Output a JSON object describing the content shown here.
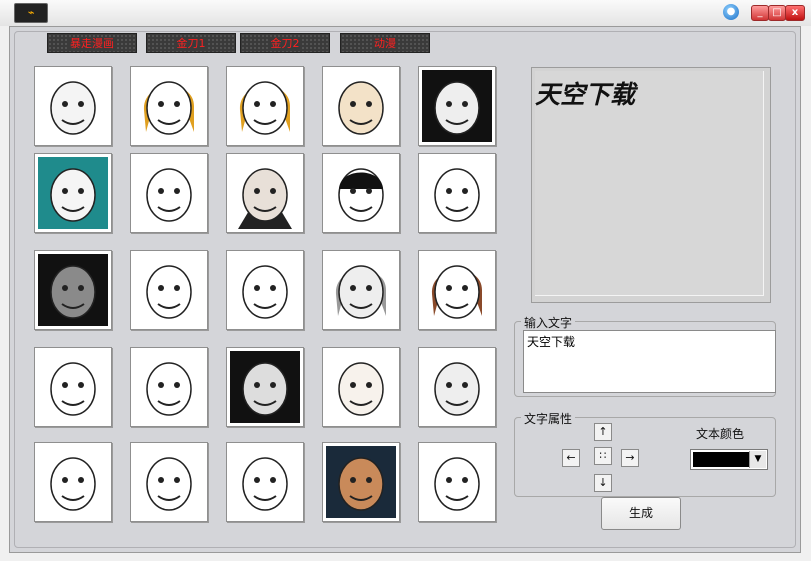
{
  "window": {
    "app_icon": "app-logo-icon",
    "min_label": "_",
    "max_label": "□",
    "close_label": "x"
  },
  "tabs": [
    {
      "label": "暴走漫画"
    },
    {
      "label": "金刀1"
    },
    {
      "label": "金刀2"
    },
    {
      "label": "动漫"
    }
  ],
  "thumbnails": [
    {
      "name": "face-01"
    },
    {
      "name": "face-02"
    },
    {
      "name": "face-03"
    },
    {
      "name": "face-04"
    },
    {
      "name": "face-05"
    },
    {
      "name": "face-06"
    },
    {
      "name": "face-07"
    },
    {
      "name": "face-08"
    },
    {
      "name": "face-09"
    },
    {
      "name": "face-10"
    },
    {
      "name": "face-11"
    },
    {
      "name": "face-12"
    },
    {
      "name": "face-13"
    },
    {
      "name": "face-14"
    },
    {
      "name": "face-15"
    },
    {
      "name": "face-16"
    },
    {
      "name": "face-17"
    },
    {
      "name": "face-18"
    },
    {
      "name": "face-19"
    },
    {
      "name": "face-20"
    },
    {
      "name": "face-21"
    },
    {
      "name": "face-22"
    },
    {
      "name": "face-23"
    },
    {
      "name": "face-24"
    },
    {
      "name": "face-25"
    }
  ],
  "preview": {
    "text": "天空下载"
  },
  "input_group": {
    "legend": "输入文字",
    "value": "天空下载"
  },
  "attr_group": {
    "legend": "文字属性"
  },
  "arrows": {
    "up": "↑",
    "down": "↓",
    "left": "←",
    "right": "→",
    "center": "∷"
  },
  "color": {
    "label": "文本颜色",
    "value": "#000000",
    "dropdown": "▼"
  },
  "generate": {
    "label": "生成"
  }
}
